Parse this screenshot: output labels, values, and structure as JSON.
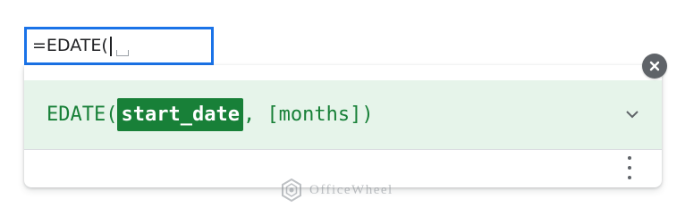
{
  "cell": {
    "formula_text": "=EDATE("
  },
  "help": {
    "function_name": "EDATE",
    "open_paren": "(",
    "active_argument": "start_date",
    "separator": ", ",
    "optional_argument": "[months]",
    "close_paren": ")"
  },
  "icons": {
    "close": "close-icon",
    "expand": "chevron-down-icon",
    "more": "more-vert-icon",
    "watermark_logo": "officewheel-logo"
  },
  "watermark": {
    "text": "OfficeWheel"
  },
  "colors": {
    "cell_border": "#1a73e8",
    "header_bg": "#e6f4ea",
    "signature_text": "#188038",
    "active_arg_bg": "#188038",
    "close_bg": "#5f6368"
  }
}
